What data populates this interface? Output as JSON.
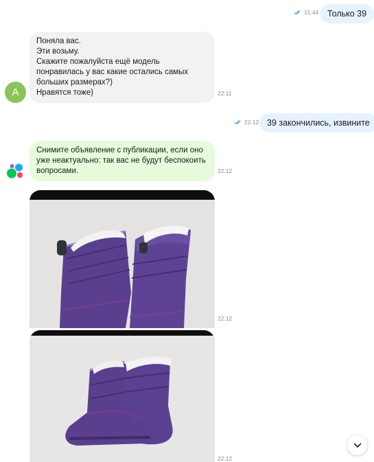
{
  "messages": {
    "m1": {
      "text": "Только 39",
      "time": "15:44"
    },
    "m2": {
      "lines": [
        "Поняла вас.",
        "Эти возьму.",
        "Скажите пожалуйста ещё модель",
        "понравилась у вас какие остались самых",
        "больших размерах?)",
        "Нравятся тоже)"
      ],
      "time": "22:11",
      "avatar_letter": "А"
    },
    "m3": {
      "text": "39 закончились, извините",
      "time": "22:12"
    },
    "m4": {
      "lines": [
        "Снимите объявление с публикации, если оно",
        "уже неактуально: так вас не будут беспокоить",
        "вопросами."
      ],
      "time": "22:12"
    },
    "photo1": {
      "time": "22:12"
    },
    "photo2": {
      "time": "22:12"
    }
  },
  "icons": {
    "read_ticks": "double-check-icon",
    "scroll_down": "chevron-down-icon",
    "system_avatar": "avito-logo-icon"
  },
  "colors": {
    "outgoing_bubble": "#e6f3ff",
    "incoming_bubble": "#f2f2f2",
    "system_bubble": "#e5fbd9",
    "read_ticks": "#3d9bf0",
    "avatar": "#8ac45a",
    "boots": "#5a3f8f"
  }
}
